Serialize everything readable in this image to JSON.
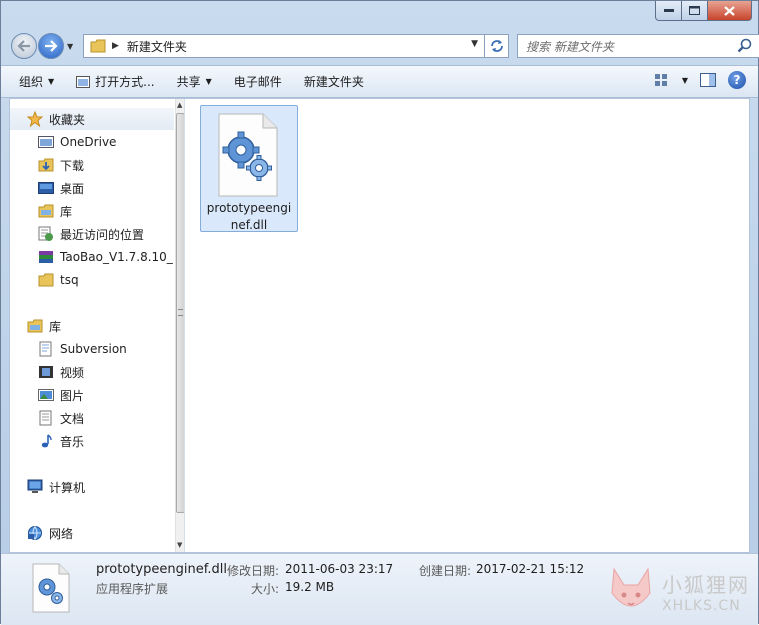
{
  "window": {
    "caption": {
      "minimize": "–",
      "maximize": "☐",
      "close": "✕"
    }
  },
  "address": {
    "current_folder": "新建文件夹",
    "search_placeholder": "搜索 新建文件夹"
  },
  "toolbar": {
    "organize": "组织",
    "open_with": "打开方式...",
    "share": "共享",
    "email": "电子邮件",
    "new_folder": "新建文件夹",
    "help": "?"
  },
  "nav": {
    "favorites": {
      "label": "收藏夹",
      "items": [
        "OneDrive",
        "下载",
        "桌面",
        "库",
        "最近访问的位置",
        "TaoBao_V1.7.8.10_",
        "tsq"
      ]
    },
    "libraries": {
      "label": "库",
      "items": [
        "Subversion",
        "视频",
        "图片",
        "文档",
        "音乐"
      ]
    },
    "computer": "计算机",
    "network": "网络"
  },
  "files": [
    {
      "name": "prototypeenginef.dll",
      "display_line1": "prototypeengi",
      "display_line2": "nef.dll",
      "icon": "dll-gear-icon"
    }
  ],
  "details": {
    "filename": "prototypeenginef.dll",
    "type": "应用程序扩展",
    "modified_label": "修改日期:",
    "modified_value": "2011-06-03 23:17",
    "created_label": "创建日期:",
    "created_value": "2017-02-21 15:12",
    "size_label": "大小:",
    "size_value": "19.2 MB"
  },
  "watermark": {
    "cn": "小狐狸网",
    "en": "XHLKS.CN"
  }
}
